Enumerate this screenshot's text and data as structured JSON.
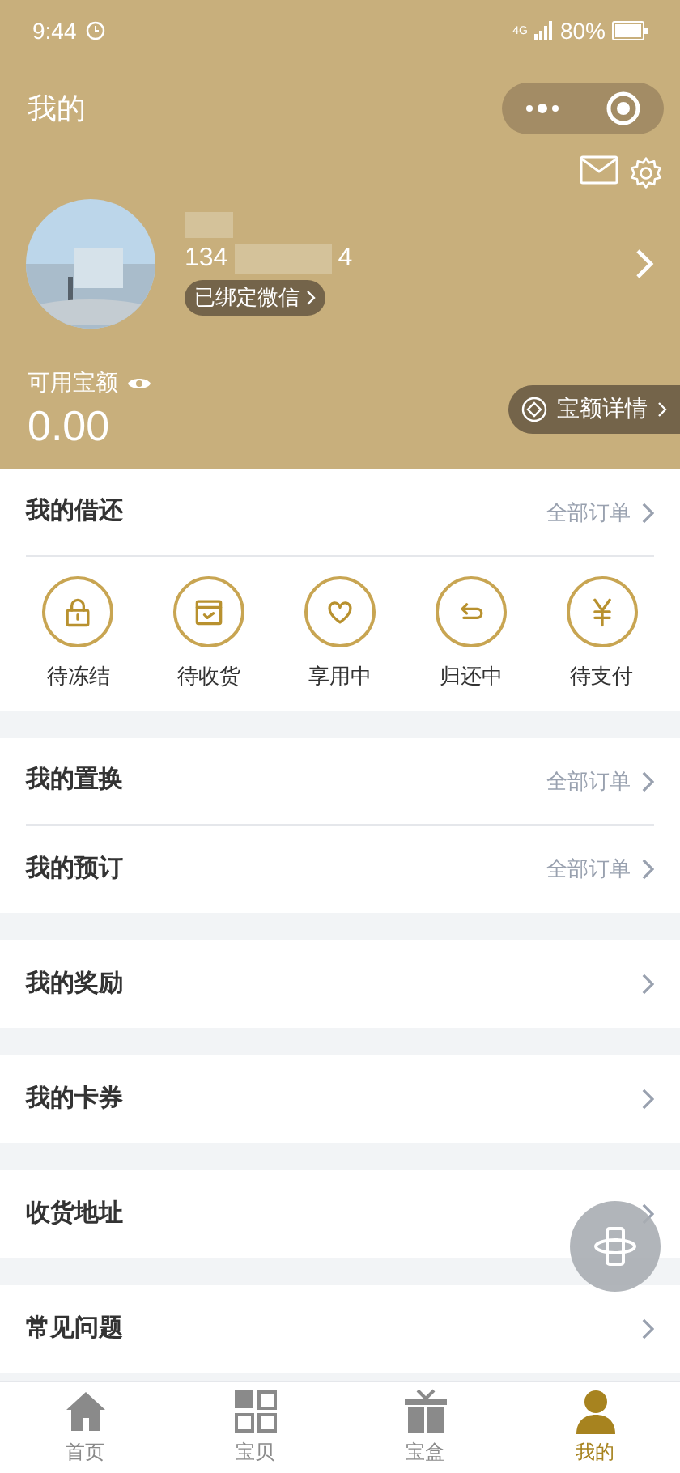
{
  "status_bar": {
    "time": "9:44",
    "network": "4G",
    "battery": "80%"
  },
  "header": {
    "title": "我的"
  },
  "profile": {
    "phone_start": "134",
    "phone_end": "4",
    "wechat_badge": "已绑定微信"
  },
  "balance": {
    "label": "可用宝额",
    "value": "0.00",
    "details_button": "宝额详情"
  },
  "orders": {
    "title": "我的借还",
    "link": "全部订单",
    "statuses": [
      {
        "kind": "lock",
        "label": "待冻结"
      },
      {
        "kind": "box",
        "label": "待收货"
      },
      {
        "kind": "heart",
        "label": "享用中"
      },
      {
        "kind": "return",
        "label": "归还中"
      },
      {
        "kind": "yen",
        "label": "待支付"
      }
    ]
  },
  "menu_groups": [
    {
      "rows": [
        {
          "title": "我的置换",
          "link": "全部订单"
        },
        {
          "title": "我的预订",
          "link": "全部订单"
        }
      ]
    },
    {
      "rows": [
        {
          "title": "我的奖励"
        }
      ]
    },
    {
      "rows": [
        {
          "title": "我的卡券"
        }
      ]
    },
    {
      "rows": [
        {
          "title": "收货地址"
        }
      ]
    },
    {
      "rows": [
        {
          "title": "常见问题"
        }
      ]
    }
  ],
  "tab_bar": [
    {
      "kind": "home",
      "label": "首页",
      "selected": false
    },
    {
      "kind": "grid",
      "label": "宝贝",
      "selected": false
    },
    {
      "kind": "gift",
      "label": "宝盒",
      "selected": false
    },
    {
      "kind": "person",
      "label": "我的",
      "selected": true
    }
  ]
}
